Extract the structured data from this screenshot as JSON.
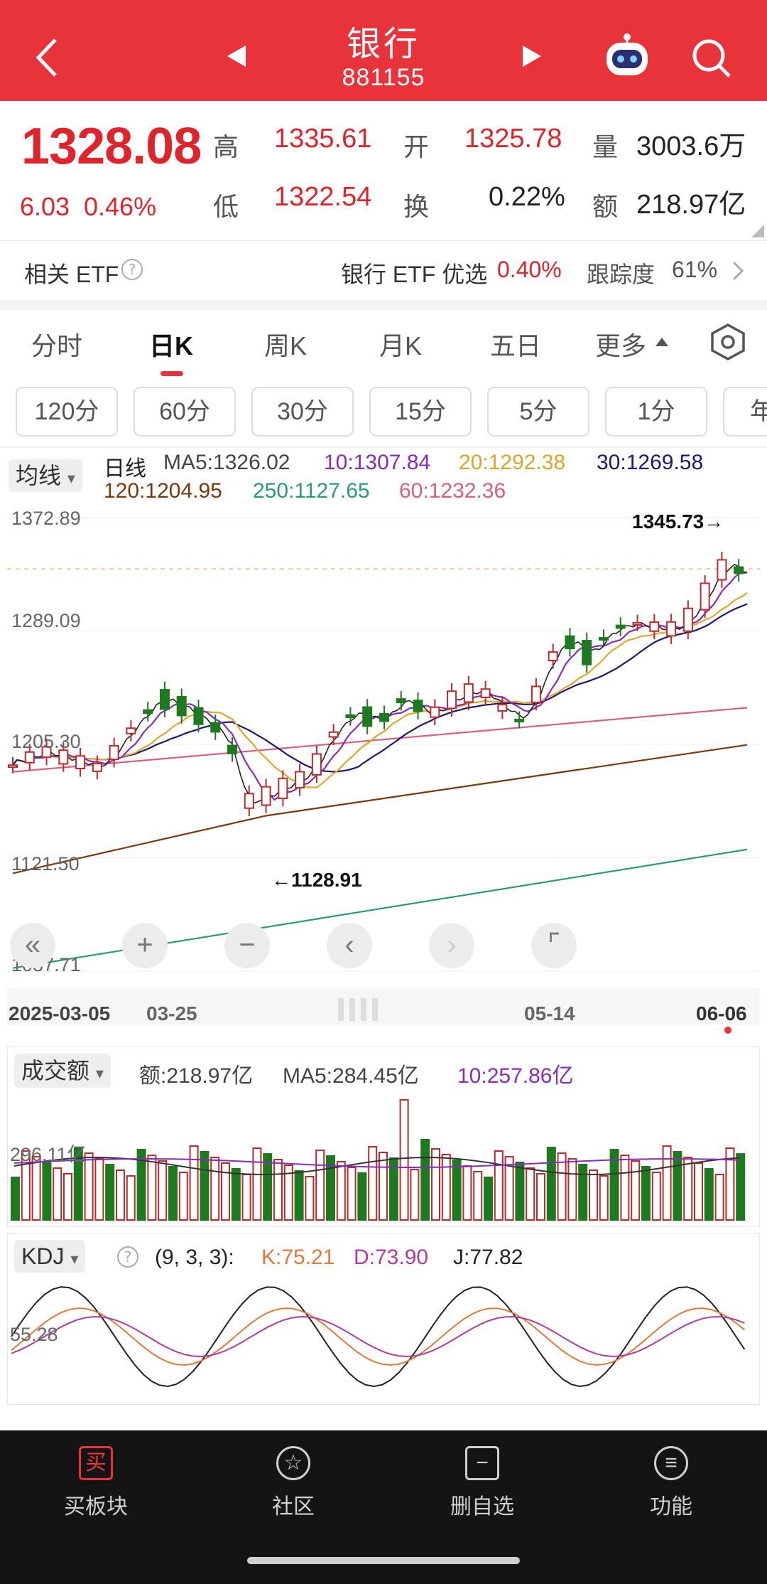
{
  "header": {
    "title": "银行",
    "code": "881155"
  },
  "quote": {
    "price": "1328.08",
    "change": "6.03",
    "change_pct": "0.46%",
    "high_label": "高",
    "high": "1335.61",
    "low_label": "低",
    "low": "1322.54",
    "open_label": "开",
    "open": "1325.78",
    "turnover_label": "换",
    "turnover": "0.22%",
    "volume_label": "量",
    "volume": "3003.6万",
    "amount_label": "额",
    "amount": "218.97亿"
  },
  "etf": {
    "label": "相关 ETF",
    "name": "银行 ETF 优选",
    "pct": "0.40%",
    "track_label": "跟踪度",
    "track": "61%"
  },
  "tabs": [
    "分时",
    "日K",
    "周K",
    "月K",
    "五日",
    "更多"
  ],
  "ktabs": [
    "120分",
    "60分",
    "30分",
    "15分",
    "5分",
    "1分",
    "年"
  ],
  "main_chart": {
    "indicator": "均线",
    "period": "日线",
    "ma5": "MA5:1326.02",
    "ma10": "10:1307.84",
    "ma20": "20:1292.38",
    "ma30": "30:1269.58",
    "ma120": "120:1204.95",
    "ma250": "250:1127.65",
    "ma60": "60:1232.36",
    "y_ticks": [
      "1372.89",
      "1289.09",
      "1205.30",
      "1121.50",
      "1037.71"
    ],
    "high_mark": "1345.73→",
    "low_mark": "←1128.91",
    "date_start": "2025-03-05",
    "date_2": "03-25",
    "date_3": "05-14",
    "date_end": "06-06"
  },
  "volume_chart": {
    "indicator": "成交额",
    "amount": "额:218.97亿",
    "ma5": "MA5:284.45亿",
    "ma10": "10:257.86亿",
    "y_tick": "296.11亿"
  },
  "kdj_chart": {
    "indicator": "KDJ",
    "params": "(9, 3, 3):",
    "k": "K:75.21",
    "d": "D:73.90",
    "j": "J:77.82",
    "y_tick": "55.28"
  },
  "nav": [
    "买板块",
    "社区",
    "删自选",
    "功能"
  ],
  "colors": {
    "accent": "#e8333a",
    "up": "#c0282c",
    "down": "#1e7a1e",
    "ma5": "#222222",
    "ma10": "#8a2bbd",
    "ma20": "#e0a82e",
    "ma30": "#1a1a6e",
    "ma60": "#d9607a",
    "ma120": "#7a3a10",
    "ma250": "#2a9a78"
  }
}
